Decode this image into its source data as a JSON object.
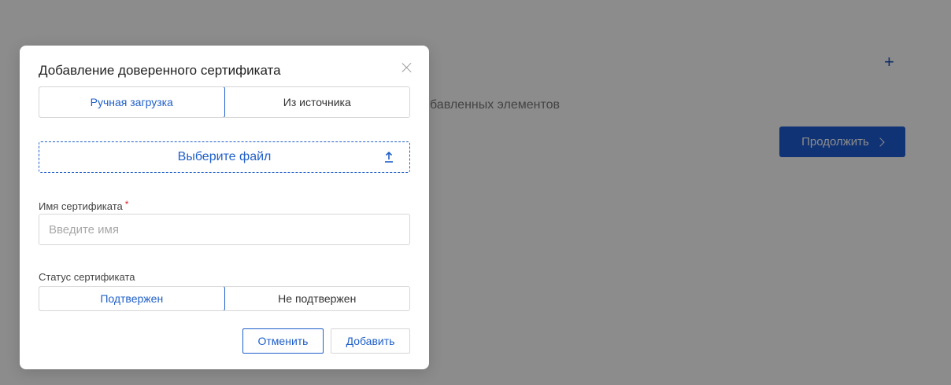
{
  "background": {
    "empty_text": "бавленных элементов",
    "continue_label": "Продолжить",
    "plus_symbol": "+"
  },
  "modal": {
    "title": "Добавление доверенного сертификата",
    "source_tabs": [
      {
        "label": "Ручная загрузка",
        "active": true
      },
      {
        "label": "Из источника",
        "active": false
      }
    ],
    "file_picker_label": "Выберите файл",
    "name_field": {
      "label": "Имя сертификата",
      "required_mark": "*",
      "placeholder": "Введите имя",
      "value": ""
    },
    "status": {
      "label": "Статус сертификата",
      "options": [
        {
          "label": "Подтвержен",
          "active": true
        },
        {
          "label": "Не подтвержен",
          "active": false
        }
      ]
    },
    "cancel_label": "Отменить",
    "add_label": "Добавить"
  },
  "colors": {
    "accent": "#1f5fc9",
    "primary_button": "#1e5ed6",
    "required": "#d9232d",
    "overlay": "rgba(0,0,0,0.45)"
  }
}
